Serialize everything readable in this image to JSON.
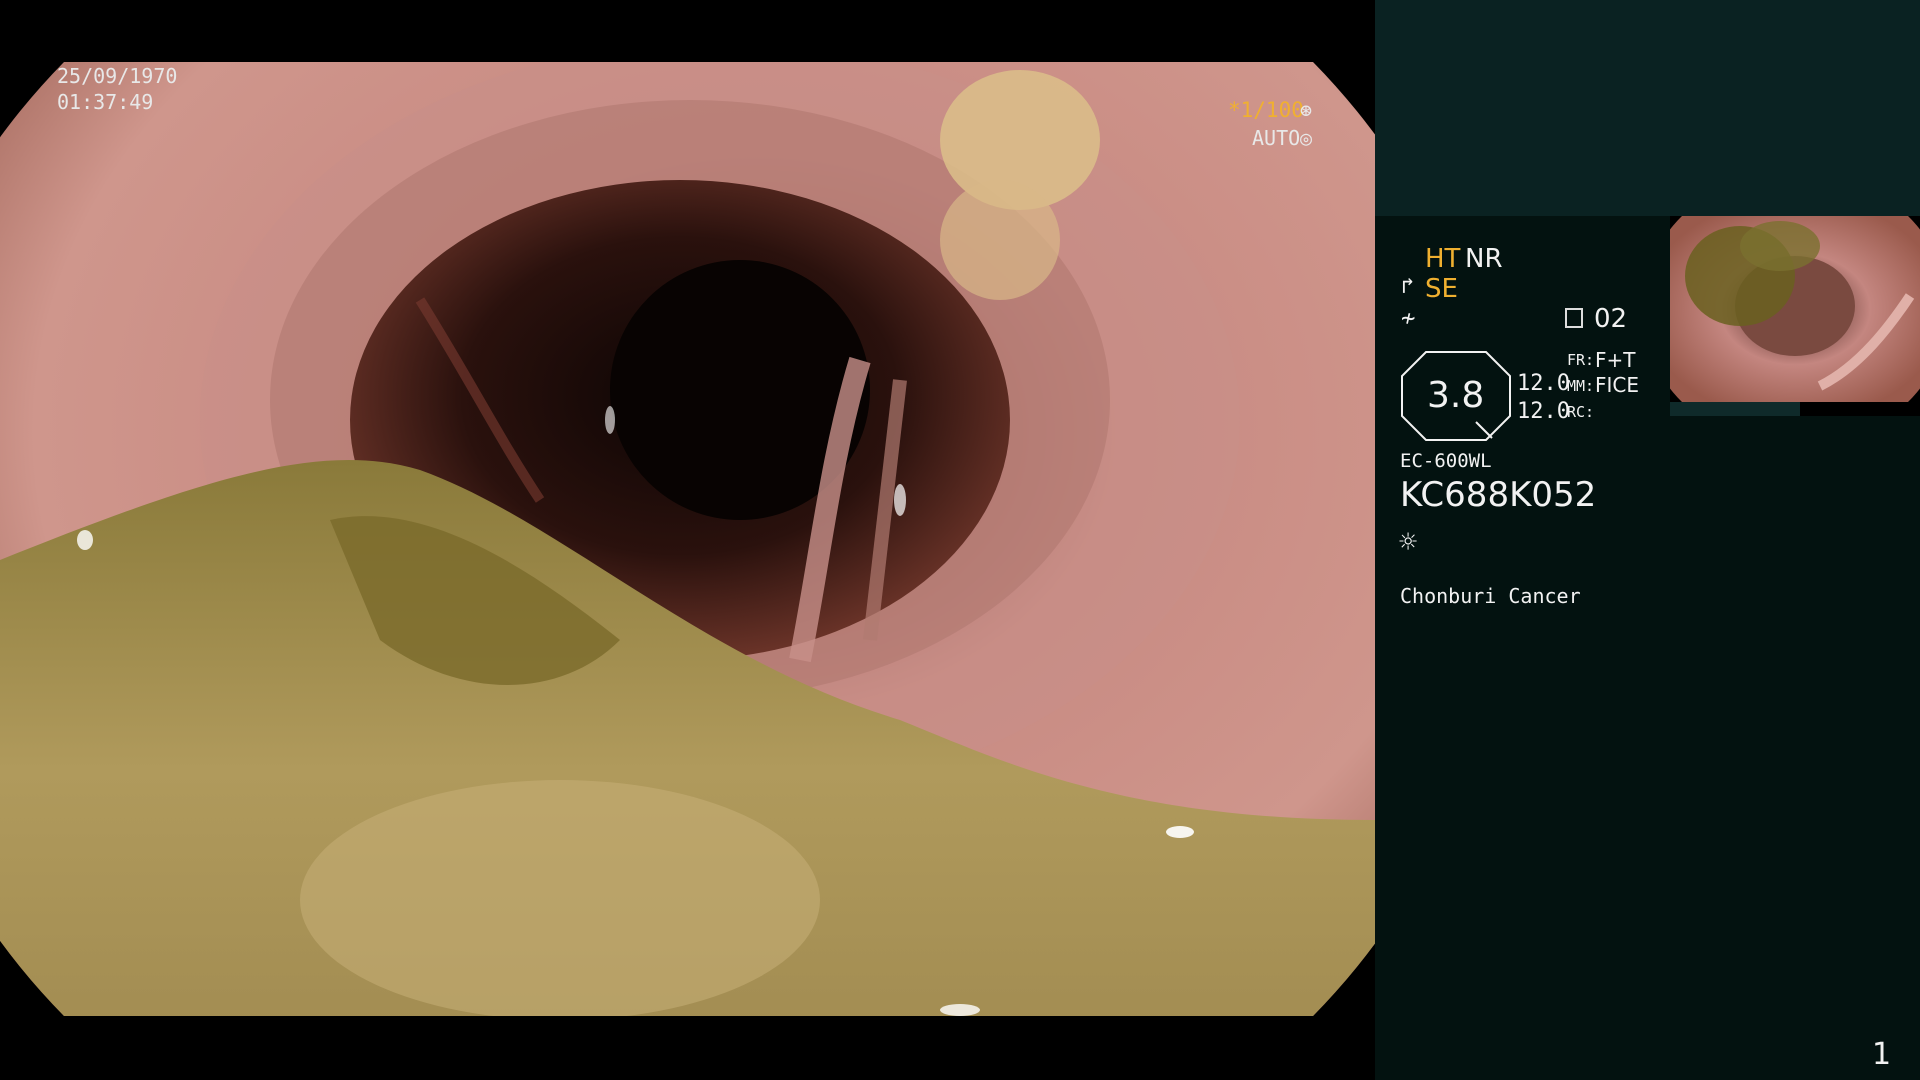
{
  "overlay": {
    "date": "25/09/1970",
    "time": "01:37:49",
    "shutter": "*1/100",
    "iris": "AUTO",
    "shutter_icon": "shutter-icon",
    "iris_icon": "iris-icon"
  },
  "panel": {
    "ht": "HT",
    "nr": "NR",
    "se": "SE",
    "memo": "02",
    "zoom": "3.8",
    "value_1": "12.0",
    "value_2": "12.0",
    "fr_label": "FR:",
    "fr_value": "F+T",
    "mm_label": "MM:",
    "mm_value": "FICE",
    "rc_label": "RC:",
    "scope_model": "EC-600WL",
    "scope_serial": "KC688K052",
    "institution": "Chonburi Cancer",
    "page_number": "1"
  },
  "colors": {
    "accent_orange": "#f0b030",
    "panel_bg": "#031210",
    "panel_top_bg": "#0a2222"
  }
}
